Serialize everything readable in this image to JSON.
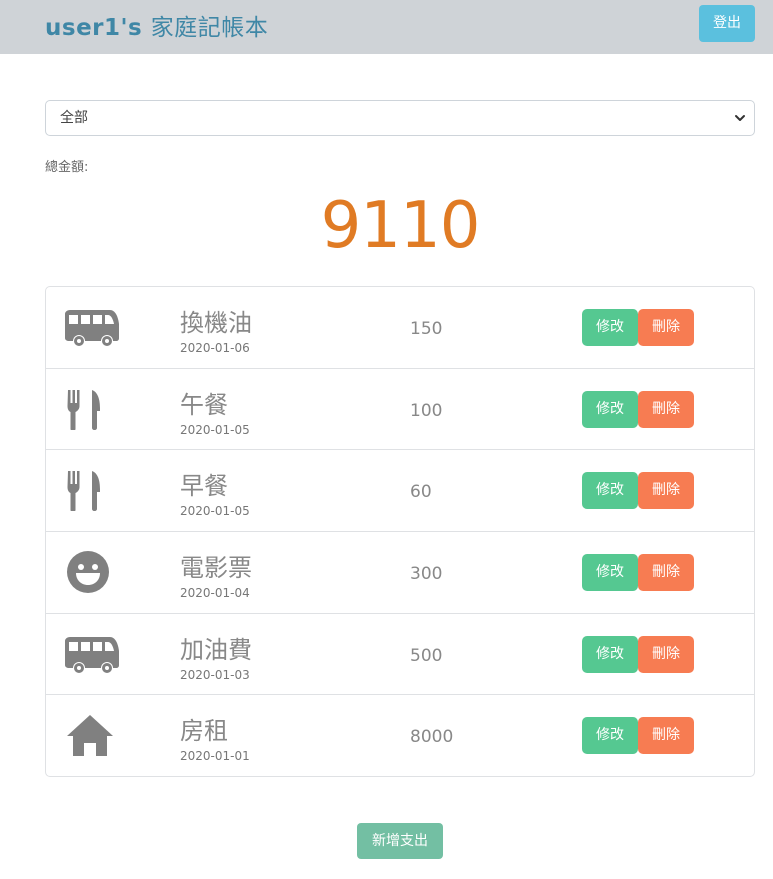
{
  "header": {
    "brand_user": "user1's",
    "brand_title": "家庭記帳本",
    "logout_label": "登出"
  },
  "filter": {
    "selected": "全部"
  },
  "total": {
    "label": "總金額:",
    "value": "9110"
  },
  "expenses": [
    {
      "icon": "bus-icon",
      "name": "換機油",
      "date": "2020-01-06",
      "amount": "150",
      "edit_label": "修改",
      "delete_label": "刪除"
    },
    {
      "icon": "utensils-icon",
      "name": "午餐",
      "date": "2020-01-05",
      "amount": "100",
      "edit_label": "修改",
      "delete_label": "刪除"
    },
    {
      "icon": "utensils-icon",
      "name": "早餐",
      "date": "2020-01-05",
      "amount": "60",
      "edit_label": "修改",
      "delete_label": "刪除"
    },
    {
      "icon": "smile-icon",
      "name": "電影票",
      "date": "2020-01-04",
      "amount": "300",
      "edit_label": "修改",
      "delete_label": "刪除"
    },
    {
      "icon": "bus-icon",
      "name": "加油費",
      "date": "2020-01-03",
      "amount": "500",
      "edit_label": "修改",
      "delete_label": "刪除"
    },
    {
      "icon": "home-icon",
      "name": "房租",
      "date": "2020-01-01",
      "amount": "8000",
      "edit_label": "修改",
      "delete_label": "刪除"
    }
  ],
  "add_button_label": "新增支出",
  "colors": {
    "header_bg": "#cfd3d7",
    "brand": "#3f87a6",
    "logout": "#5bc0de",
    "total": "#e07b24",
    "edit": "#55c891",
    "delete": "#f77c52",
    "add": "#73bfa3",
    "icon": "#808080"
  }
}
